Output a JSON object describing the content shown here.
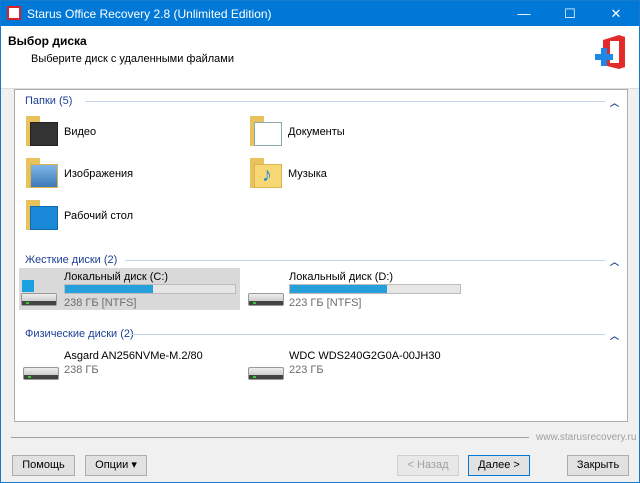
{
  "window": {
    "title": "Starus Office Recovery 2.8 (Unlimited Edition)",
    "minimize": "—",
    "maximize": "☐",
    "close": "✕",
    "accent": "#0078d7"
  },
  "header": {
    "title": "Выбор диска",
    "subtitle": "Выберите диск с удаленными файлами"
  },
  "folders": {
    "label": "Папки (5)",
    "items": [
      {
        "label": "Видео",
        "icon": "video-folder-icon"
      },
      {
        "label": "Документы",
        "icon": "documents-folder-icon"
      },
      {
        "label": "Изображения",
        "icon": "pictures-folder-icon"
      },
      {
        "label": "Музыка",
        "icon": "music-folder-icon"
      },
      {
        "label": "Рабочий стол",
        "icon": "desktop-folder-icon"
      }
    ]
  },
  "hard_disks": {
    "label": "Жесткие диски (2)",
    "items": [
      {
        "name": "Локальный диск (C:)",
        "info": "238 ГБ [NTFS]",
        "used_fraction": 0.52,
        "selected": true
      },
      {
        "name": "Локальный диск (D:)",
        "info": "223 ГБ [NTFS]",
        "used_fraction": 0.57
      }
    ]
  },
  "physical_disks": {
    "label": "Физические диски (2)",
    "items": [
      {
        "name": "Asgard AN256NVMe-M.2/80",
        "info": "238 ГБ"
      },
      {
        "name": "WDC WDS240G2G0A-00JH30",
        "info": "223 ГБ"
      }
    ]
  },
  "footer": {
    "site": "www.starusrecovery.ru",
    "help": "Помощь",
    "options": "Опции ▾",
    "back": "< Назад",
    "next": "Далее >",
    "close": "Закрыть"
  }
}
